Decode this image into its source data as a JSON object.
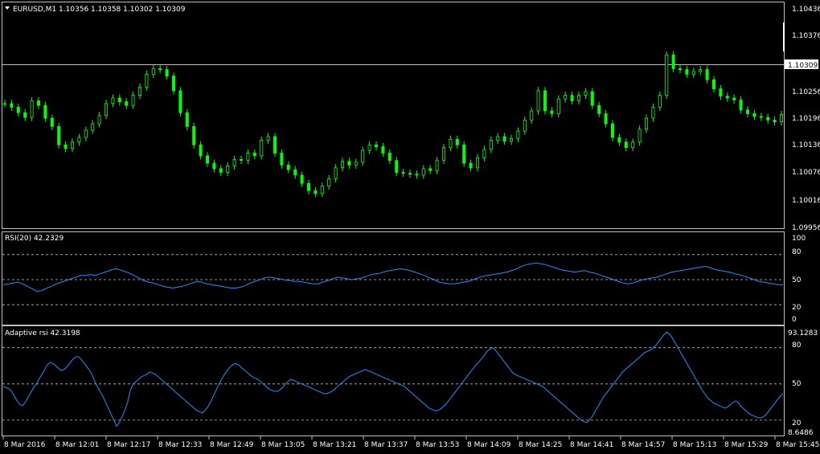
{
  "main_panel": {
    "header": "EURUSD,M1  1.10356 1.10358 1.10302 1.10309",
    "price_axis": [
      "1.10436",
      "1.10376",
      "1.10309",
      "1.10256",
      "1.10196",
      "1.10136",
      "1.10076",
      "1.10016",
      "1.09956"
    ],
    "current_price": "1.10309",
    "chart_data": {
      "type": "candlestick",
      "symbol": "EURUSD",
      "timeframe": "M1",
      "ylim": [
        1.09956,
        1.10436
      ],
      "last_close": 1.10309,
      "close_series": [
        1.10226,
        1.10218,
        1.10206,
        1.10196,
        1.10232,
        1.10222,
        1.10194,
        1.10176,
        1.10136,
        1.10128,
        1.10142,
        1.10152,
        1.10168,
        1.10182,
        1.102,
        1.10226,
        1.10238,
        1.1023,
        1.10222,
        1.10244,
        1.10262,
        1.1029,
        1.10302,
        1.103,
        1.10286,
        1.10254,
        1.10206,
        1.10176,
        1.10136,
        1.10112,
        1.10096,
        1.10084,
        1.10076,
        1.1009,
        1.10104,
        1.10102,
        1.10118,
        1.10112,
        1.10146,
        1.10154,
        1.10118,
        1.10092,
        1.10082,
        1.1007,
        1.10052,
        1.10036,
        1.1003,
        1.10046,
        1.10062,
        1.10086,
        1.101,
        1.10092,
        1.10098,
        1.10124,
        1.10136,
        1.10132,
        1.10118,
        1.10102,
        1.10076,
        1.10074,
        1.10072,
        1.1007,
        1.10084,
        1.1008,
        1.10102,
        1.1013,
        1.10148,
        1.10136,
        1.10096,
        1.10086,
        1.10108,
        1.10126,
        1.10146,
        1.10154,
        1.10144,
        1.1015,
        1.10166,
        1.1019,
        1.1021,
        1.10254,
        1.1021,
        1.10204,
        1.10236,
        1.10244,
        1.10232,
        1.10244,
        1.10252,
        1.10222,
        1.10204,
        1.10182,
        1.10152,
        1.10142,
        1.1013,
        1.10142,
        1.1017,
        1.10194,
        1.10218,
        1.10244,
        1.10332,
        1.10302,
        1.103,
        1.1029,
        1.10296,
        1.103,
        1.10278,
        1.10258,
        1.10242,
        1.10238,
        1.10234,
        1.10212,
        1.10204,
        1.10198,
        1.10196,
        1.1019,
        1.10186,
        1.10202
      ]
    }
  },
  "rsi_panel": {
    "header": "RSI(20) 42.2329",
    "axis_labels": [
      "100",
      "80",
      "50",
      "20",
      "0"
    ],
    "chart_data": {
      "type": "line",
      "name": "RSI(20)",
      "last_value": 42.2329,
      "ylim": [
        0,
        100
      ],
      "levels": [
        80,
        50,
        20
      ],
      "values": [
        44,
        45,
        46,
        47,
        45,
        42,
        39,
        36,
        37,
        40,
        42,
        45,
        47,
        49,
        51,
        53,
        55,
        55,
        56,
        55,
        57,
        59,
        61,
        63,
        62,
        60,
        58,
        55,
        52,
        49,
        47,
        46,
        44,
        42,
        41,
        40,
        41,
        42,
        44,
        46,
        48,
        47,
        45,
        44,
        43,
        42,
        41,
        40,
        40,
        41,
        43,
        46,
        48,
        50,
        52,
        53,
        52,
        51,
        50,
        49,
        48,
        48,
        47,
        46,
        45,
        45,
        47,
        49,
        51,
        53,
        52,
        51,
        50,
        51,
        52,
        54,
        56,
        57,
        58,
        60,
        61,
        62,
        63,
        62,
        61,
        59,
        57,
        55,
        52,
        50,
        47,
        46,
        45,
        45,
        46,
        47,
        48,
        50,
        52,
        54,
        55,
        56,
        57,
        58,
        59,
        61,
        63,
        66,
        68,
        69,
        70,
        69,
        68,
        66,
        64,
        62,
        61,
        60,
        59,
        60,
        61,
        59,
        58,
        56,
        54,
        52,
        50,
        48,
        46,
        45,
        46,
        48,
        50,
        51,
        52,
        53,
        55,
        57,
        59,
        60,
        61,
        62,
        63,
        64,
        65,
        66,
        64,
        62,
        61,
        60,
        59,
        57,
        56,
        54,
        52,
        50,
        48,
        47,
        46,
        45,
        44,
        44
      ]
    }
  },
  "adaptive_rsi_panel": {
    "header": "Adaptive rsi 42.3198",
    "axis_labels": [
      "93.1283",
      "80",
      "50",
      "20",
      "8.6486"
    ],
    "chart_data": {
      "type": "line",
      "name": "Adaptive rsi",
      "last_value": 42.3198,
      "ylim": [
        8.6486,
        93.1283
      ],
      "levels": [
        80,
        50,
        20
      ],
      "values": [
        48,
        47,
        46,
        44,
        40,
        36,
        33,
        32,
        35,
        39,
        43,
        47,
        50,
        54,
        58,
        62,
        66,
        68,
        67,
        65,
        63,
        61,
        62,
        64,
        67,
        70,
        72,
        73,
        71,
        68,
        65,
        62,
        58,
        53,
        48,
        44,
        40,
        35,
        30,
        25,
        20,
        15,
        18,
        23,
        28,
        35,
        45,
        50,
        52,
        54,
        56,
        57,
        58,
        60,
        59,
        58,
        56,
        54,
        52,
        50,
        48,
        46,
        44,
        42,
        40,
        38,
        36,
        34,
        32,
        30,
        28,
        27,
        26,
        28,
        31,
        35,
        40,
        45,
        50,
        54,
        58,
        61,
        64,
        66,
        67,
        66,
        64,
        62,
        60,
        58,
        56,
        55,
        54,
        52,
        50,
        48,
        46,
        45,
        44,
        44,
        45,
        47,
        50,
        52,
        54,
        53,
        52,
        51,
        50,
        49,
        48,
        47,
        46,
        45,
        44,
        43,
        42,
        42,
        43,
        44,
        46,
        48,
        50,
        52,
        54,
        56,
        57,
        58,
        59,
        60,
        61,
        62,
        61,
        60,
        59,
        58,
        57,
        56,
        55,
        54,
        53,
        52,
        51,
        50,
        49,
        48,
        46,
        44,
        42,
        40,
        38,
        36,
        34,
        32,
        30,
        29,
        28,
        28,
        29,
        31,
        33,
        36,
        39,
        42,
        45,
        48,
        51,
        54,
        57,
        60,
        63,
        66,
        68,
        71,
        74,
        77,
        79,
        80,
        78,
        75,
        72,
        69,
        66,
        63,
        60,
        58,
        57,
        56,
        55,
        54,
        53,
        52,
        51,
        50,
        49,
        48,
        46,
        44,
        42,
        40,
        38,
        36,
        34,
        32,
        30,
        28,
        26,
        24,
        22,
        20,
        19,
        18,
        20,
        23,
        27,
        31,
        35,
        39,
        42,
        45,
        48,
        51,
        54,
        57,
        60,
        62,
        64,
        66,
        68,
        70,
        72,
        74,
        76,
        77,
        78,
        80,
        82,
        85,
        88,
        91,
        93,
        91,
        88,
        84,
        80,
        76,
        72,
        68,
        64,
        60,
        56,
        52,
        48,
        44,
        41,
        38,
        36,
        34,
        33,
        32,
        31,
        30,
        31,
        33,
        35,
        36,
        34,
        31,
        29,
        27,
        25,
        24,
        23,
        22,
        22,
        23,
        25,
        28,
        31,
        34,
        37,
        40,
        42
      ]
    }
  },
  "time_axis": [
    "8 Mar 2016",
    "8 Mar 12:01",
    "8 Mar 12:17",
    "8 Mar 12:33",
    "8 Mar 12:49",
    "8 Mar 13:05",
    "8 Mar 13:21",
    "8 Mar 13:37",
    "8 Mar 13:53",
    "8 Mar 14:09",
    "8 Mar 14:25",
    "8 Mar 14:41",
    "8 Mar 14:57",
    "8 Mar 15:13",
    "8 Mar 15:29",
    "8 Mar 15:45"
  ],
  "colors": {
    "background": "#000000",
    "bull_candle": "#00ff00",
    "bear_candle": "#00ff00",
    "rsi_line": "#1e90ff",
    "grid_level": "#c0c0c0",
    "text": "#ffffff",
    "price_line": "#c0c0c0"
  }
}
